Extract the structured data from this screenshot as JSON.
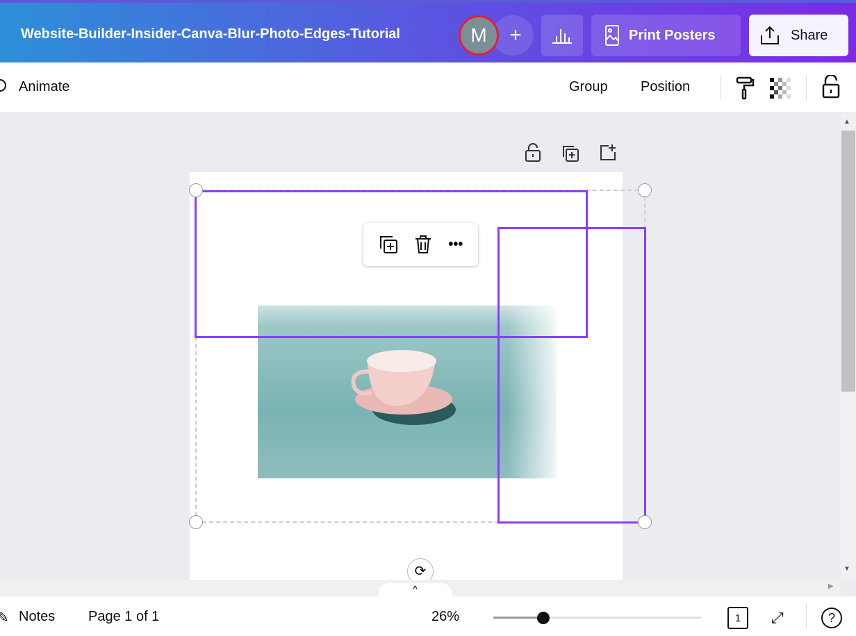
{
  "header": {
    "title": "Website-Builder-Insider-Canva-Blur-Photo-Edges-Tutorial",
    "avatar_initial": "M",
    "add_label": "+",
    "print_label": "Print Posters",
    "share_label": "Share"
  },
  "toolbar": {
    "animate": "Animate",
    "group": "Group",
    "position": "Position"
  },
  "context_menu": {
    "more": "•••"
  },
  "bottom": {
    "notes": "Notes",
    "page": "Page 1 of 1",
    "zoom": "26%",
    "zoom_value": 26,
    "page_count": "1",
    "help": "?",
    "expand": "^"
  }
}
